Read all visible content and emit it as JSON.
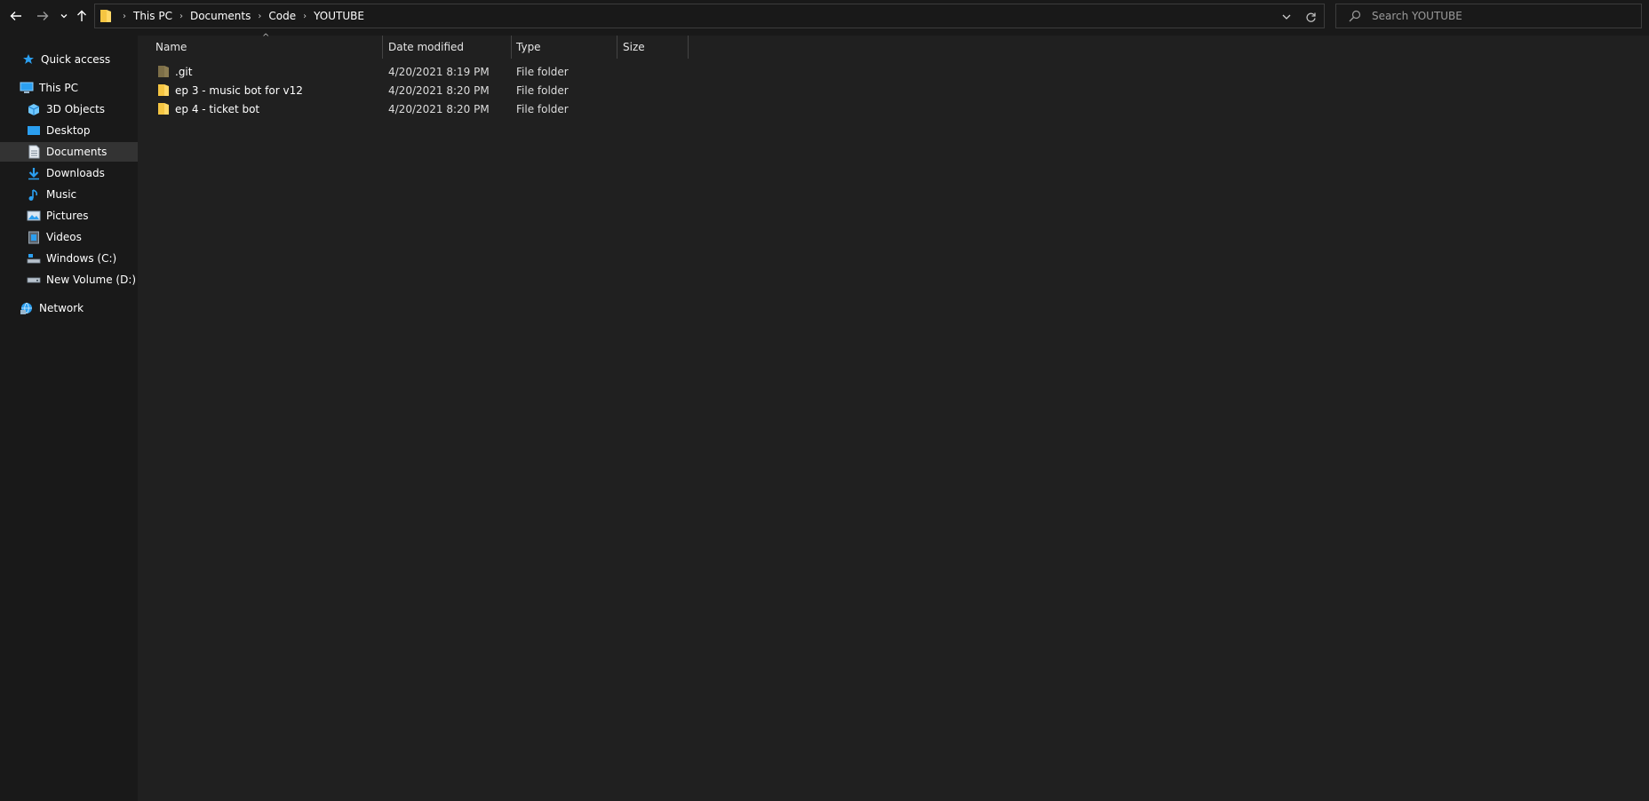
{
  "address_bar": {
    "breadcrumbs": [
      "This PC",
      "Documents",
      "Code",
      "YOUTUBE"
    ],
    "folder_icon": "folder-icon",
    "dropdown_icon": "chevron-down-icon",
    "refresh_icon": "refresh-icon"
  },
  "search": {
    "placeholder": "Search YOUTUBE",
    "value": ""
  },
  "nav_buttons": {
    "back_icon": "arrow-left-icon",
    "forward_icon": "arrow-right-icon",
    "recent_icon": "chevron-down-icon",
    "up_icon": "arrow-up-icon"
  },
  "navigation_pane": {
    "items": [
      {
        "label": "Quick access",
        "icon": "star-icon"
      },
      {
        "label": "This PC",
        "icon": "computer-icon"
      },
      {
        "label": "3D Objects",
        "icon": "cube-icon"
      },
      {
        "label": "Desktop",
        "icon": "desktop-icon"
      },
      {
        "label": "Documents",
        "icon": "document-icon",
        "selected": true
      },
      {
        "label": "Downloads",
        "icon": "download-icon"
      },
      {
        "label": "Music",
        "icon": "music-icon"
      },
      {
        "label": "Pictures",
        "icon": "picture-icon"
      },
      {
        "label": "Videos",
        "icon": "video-icon"
      },
      {
        "label": "Windows (C:)",
        "icon": "drive-icon"
      },
      {
        "label": "New Volume (D:)",
        "icon": "drive-icon"
      },
      {
        "label": "Network",
        "icon": "network-icon"
      }
    ]
  },
  "columns": [
    "Name",
    "Date modified",
    "Type",
    "Size"
  ],
  "files": [
    {
      "name": ".git",
      "date_modified": "4/20/2021 8:19 PM",
      "type": "File folder",
      "size": "",
      "hidden": true
    },
    {
      "name": "ep 3 - music bot for v12",
      "date_modified": "4/20/2021 8:20 PM",
      "type": "File folder",
      "size": ""
    },
    {
      "name": "ep 4 - ticket bot",
      "date_modified": "4/20/2021 8:20 PM",
      "type": "File folder",
      "size": ""
    }
  ],
  "colors": {
    "background": "#191919",
    "content_background": "#202020",
    "folder": "#ffd866",
    "hidden_folder": "#8b7c52",
    "accent_blue": "#2b9ff0",
    "selected_row": "#333333"
  }
}
